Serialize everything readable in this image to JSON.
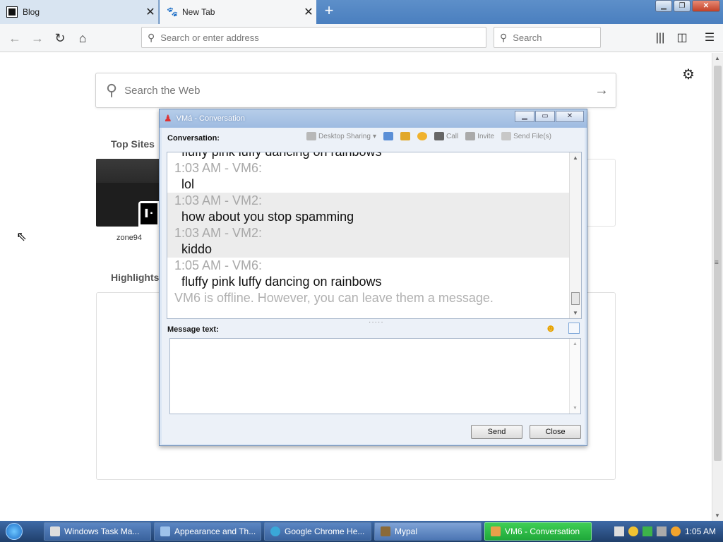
{
  "browser": {
    "tabs": [
      {
        "title": "Blog",
        "icon": "blog-favicon"
      },
      {
        "title": "New Tab",
        "icon": "mypal-favicon"
      }
    ],
    "url_placeholder": "Search or enter address",
    "search_placeholder": "Search"
  },
  "newtab": {
    "search_placeholder": "Search the Web",
    "top_sites_label": "Top Sites",
    "highlights_label": "Highlights",
    "sites": [
      {
        "label": "zone94"
      }
    ]
  },
  "dialog": {
    "title": "VMá - Conversation",
    "conversation_label": "Conversation:",
    "toolbar": {
      "desktop_sharing": "Desktop Sharing",
      "call": "Call",
      "invite": "Invite",
      "send_files": "Send File(s)"
    },
    "messages": [
      {
        "kind": "text",
        "text": "fluffy pink luffy dancing on rainbows",
        "shaded": false
      },
      {
        "kind": "meta",
        "text": "1:03 AM - VM6:",
        "shaded": false
      },
      {
        "kind": "text",
        "text": "lol",
        "shaded": false
      },
      {
        "kind": "meta",
        "text": "1:03 AM - VM2:",
        "shaded": true
      },
      {
        "kind": "text",
        "text": "how about you stop spamming",
        "shaded": true
      },
      {
        "kind": "meta",
        "text": "1:03 AM - VM2:",
        "shaded": true
      },
      {
        "kind": "text",
        "text": "kiddo",
        "shaded": true
      },
      {
        "kind": "meta",
        "text": "1:05 AM - VM6:",
        "shaded": false
      },
      {
        "kind": "text",
        "text": "fluffy pink luffy dancing on rainbows",
        "shaded": false
      }
    ],
    "offline_notice": "VM6 is offline. However, you can leave them a message.",
    "message_text_label": "Message text:",
    "message_value": "",
    "send_label": "Send",
    "close_label": "Close"
  },
  "taskbar": {
    "items": [
      {
        "label": "Windows Task Ma...",
        "active": false
      },
      {
        "label": "Appearance and Th...",
        "active": false
      },
      {
        "label": "Google Chrome He...",
        "active": false
      },
      {
        "label": "Mypal",
        "active": false
      },
      {
        "label": "VM6 - Conversation",
        "active": true
      }
    ],
    "clock": "1:05 AM"
  },
  "colors": {
    "taskbar": "#2f5590",
    "active_task": "#2fbf4a",
    "dialog_border": "#6f8fb8"
  }
}
